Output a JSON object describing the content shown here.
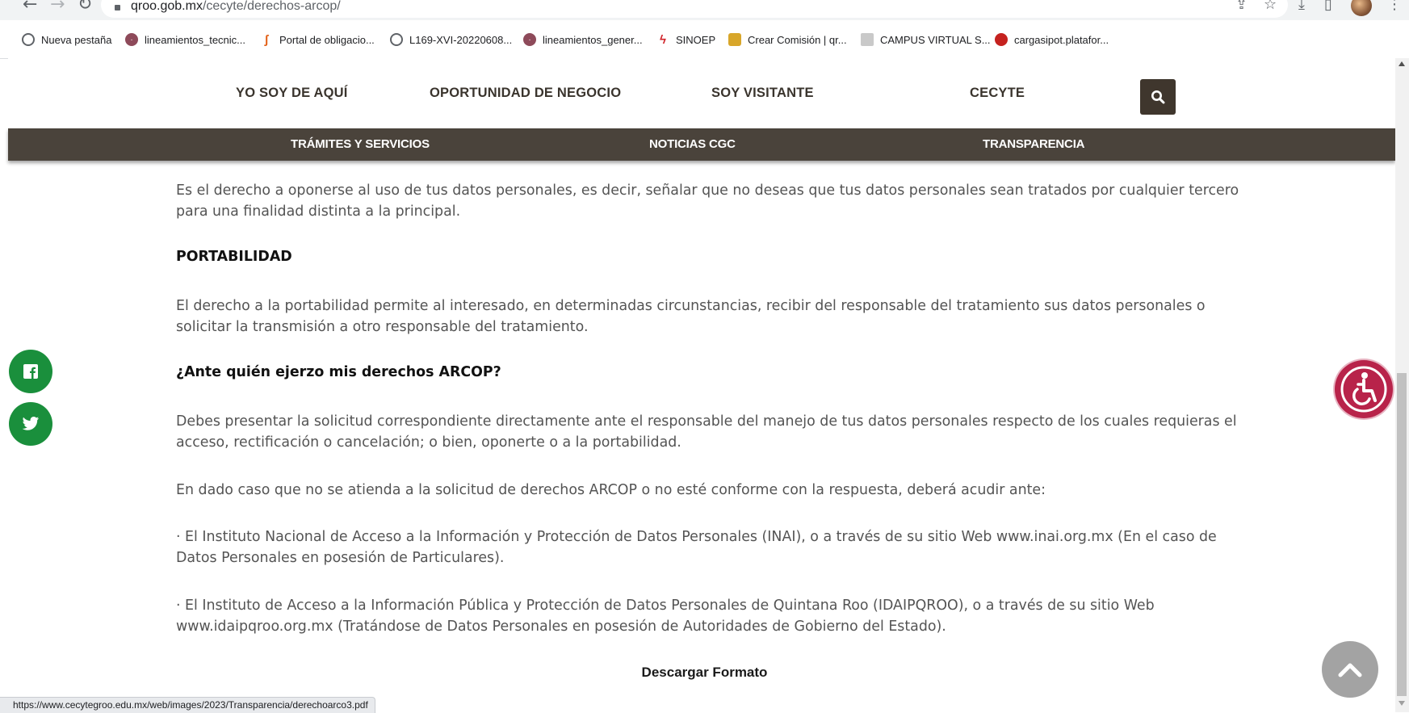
{
  "browser": {
    "url_host": "qroo.gob.mx",
    "url_path": "/cecyte/derechos-arcop/",
    "bookmarks": [
      {
        "label": "Nueva pestaña",
        "icon": "globe-icon"
      },
      {
        "label": "lineamientos_tecnic...",
        "icon": "site-favicon"
      },
      {
        "label": "Portal de obligacio...",
        "icon": "portal-favicon"
      },
      {
        "label": "L169-XVI-20220608...",
        "icon": "globe-icon"
      },
      {
        "label": "lineamientos_gener...",
        "icon": "site-favicon"
      },
      {
        "label": "SINOEP",
        "icon": "sinoep-favicon"
      },
      {
        "label": "Crear Comisión | qr...",
        "icon": "gold-favicon"
      },
      {
        "label": "CAMPUS VIRTUAL S...",
        "icon": "campus-favicon"
      },
      {
        "label": "cargasipot.platafor...",
        "icon": "cargasipot-favicon"
      }
    ],
    "status_url": "https://www.cecytegroo.edu.mx/web/images/2023/Transparencia/derechoarco3.pdf"
  },
  "site": {
    "nav": [
      "YO SOY DE AQUÍ",
      "OPORTUNIDAD DE NEGOCIO",
      "SOY VISITANTE",
      "CECYTE"
    ],
    "subnav": [
      "TRÁMITES Y SERVICIOS",
      "NOTICIAS CGC",
      "TRANSPARENCIA"
    ],
    "colors": {
      "header_dark": "#4a433b",
      "social_green": "#1a8f3c",
      "accessibility": "#b8234a"
    }
  },
  "content": {
    "p_oposicion": "Es el derecho a oponerse al uso de tus datos personales, es decir, señalar que no deseas que tus datos personales sean tratados por cualquier tercero para una finalidad distinta a la principal.",
    "h_portabilidad": "PORTABILIDAD",
    "p_portabilidad": "El derecho a la portabilidad permite al interesado, en determinadas circunstancias, recibir del responsable del tratamiento sus datos personales o solicitar la transmisión a otro responsable del tratamiento.",
    "h_ante_quien": "¿Ante quién ejerzo mis derechos ARCOP?",
    "p_presentar": "Debes presentar la solicitud correspondiente directamente ante el responsable del manejo de tus datos personales respecto de los cuales requieras el acceso, rectificación o cancelación; o bien, oponerte o a la portabilidad.",
    "p_dado_caso": "En dado caso que no se atienda a la solicitud de derechos ARCOP o no esté conforme con la respuesta, deberá acudir ante:",
    "p_inai": "· El Instituto Nacional de Acceso a la Información y Protección de Datos Personales (INAI), o a través de su sitio Web www.inai.org.mx (En el caso de Datos Personales en posesión de Particulares).",
    "p_idaipqroo": "· El Instituto de Acceso a la Información Pública y Protección de Datos Personales de Quintana Roo (IDAIPQROO), o a través de su sitio Web www.idaipqroo.org.mx (Tratándose de Datos Personales en posesión de Autoridades de Gobierno del Estado).",
    "download_label": "Descargar Formato"
  }
}
